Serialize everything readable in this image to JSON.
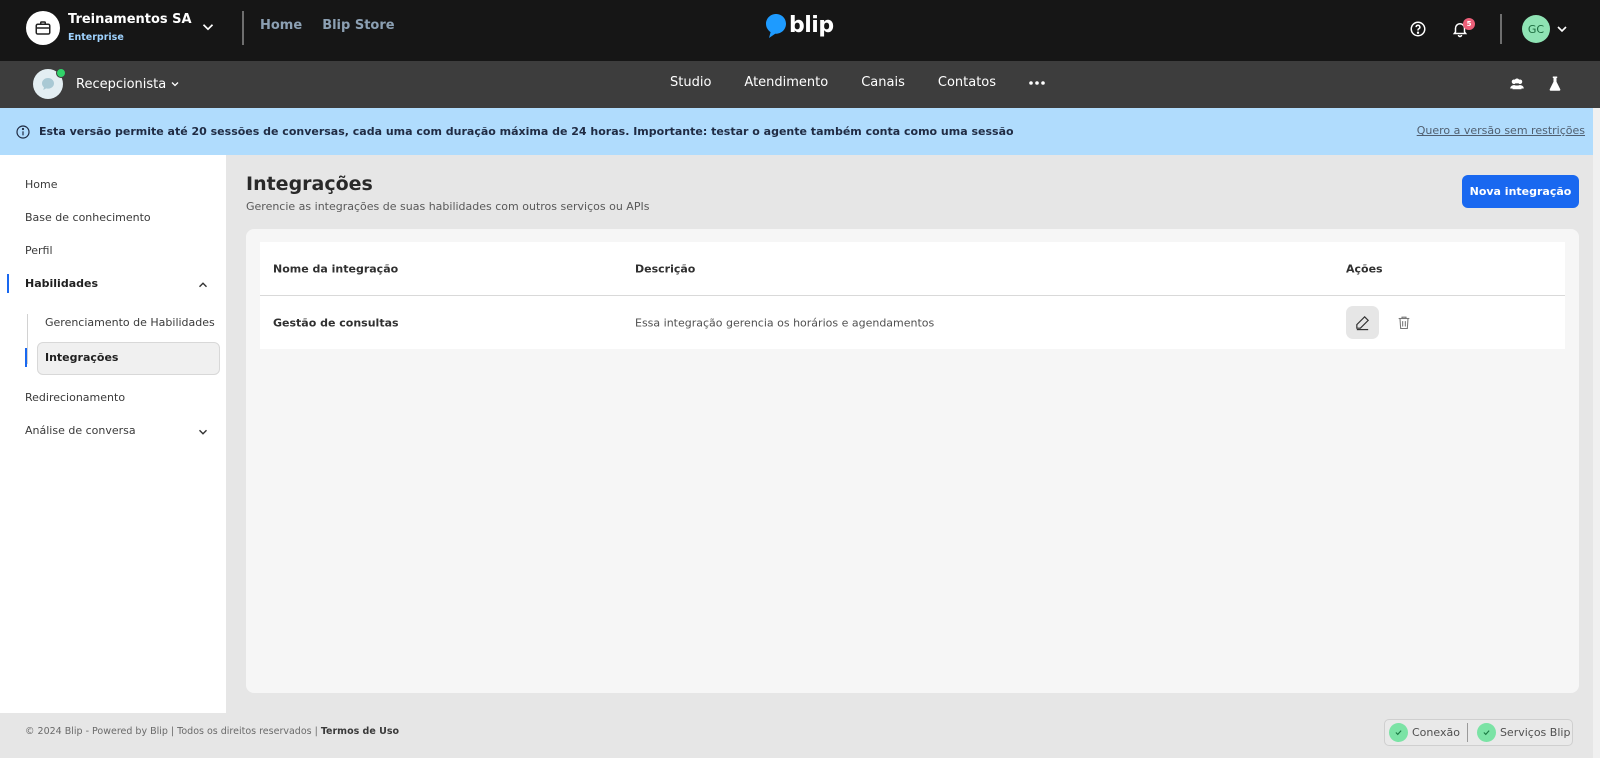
{
  "topbar": {
    "org_name": "Treinamentos SA",
    "org_plan": "Enterprise",
    "nav": [
      "Home",
      "Blip Store"
    ],
    "brand": "blip",
    "notification_count": "5",
    "user_initials": "GC"
  },
  "subbar": {
    "bot_name": "Recepcionista",
    "nav": [
      "Studio",
      "Atendimento",
      "Canais",
      "Contatos"
    ]
  },
  "banner": {
    "text": "Esta versão permite até 20 sessões de conversas, cada uma com duração máxima de 24 horas. Importante: testar o agente também conta como uma sessão",
    "link": "Quero a versão sem restrições"
  },
  "sidebar": {
    "items": [
      "Home",
      "Base de conhecimento",
      "Perfil",
      "Habilidades",
      "Redirecionamento",
      "Análise de conversa"
    ],
    "sub_items": [
      "Gerenciamento de Habilidades",
      "Integrações"
    ]
  },
  "main": {
    "title": "Integrações",
    "subtitle": "Gerencie as integrações de suas habilidades com outros serviços ou APIs",
    "new_button": "Nova integração",
    "table": {
      "headers": [
        "Nome da integração",
        "Descrição",
        "Ações"
      ],
      "rows": [
        {
          "name": "Gestão de consultas",
          "description": "Essa integração gerencia os horários e agendamentos"
        }
      ]
    }
  },
  "footer": {
    "copyright": "© 2024 Blip - Powered by Blip | Todos os direitos reservados | ",
    "terms": "Termos de Uso",
    "status": [
      "Conexão",
      "Serviços Blip"
    ]
  },
  "colors": {
    "topbar": "#161616",
    "subbar": "#3d3d3d",
    "banner": "#b0dcfd",
    "primary": "#1968f0",
    "online": "#31d36a",
    "status_ok": "#7be3a5",
    "badge": "#ec5f79"
  }
}
